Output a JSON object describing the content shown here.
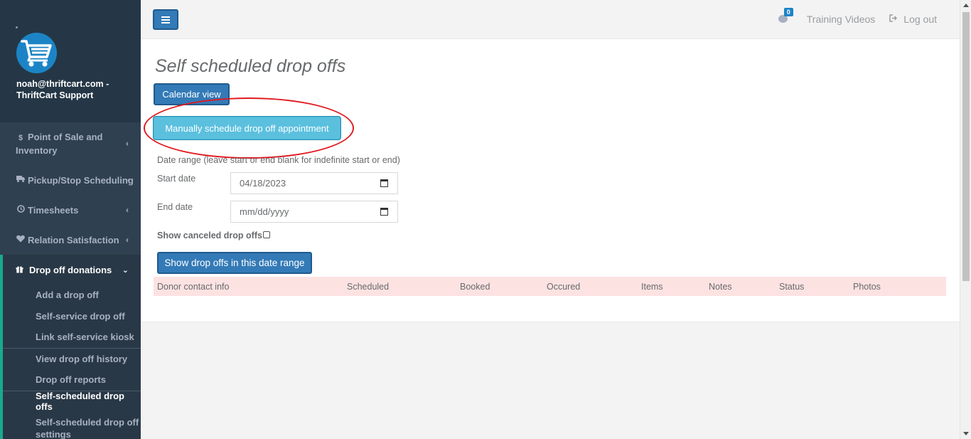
{
  "profile": {
    "name": "noah@thriftcart.com - ThriftCart Support"
  },
  "sidebar": {
    "items": [
      {
        "icon": "$",
        "label": "Point of Sale and Inventory"
      },
      {
        "icon": "truck-icon",
        "label": "Pickup/Stop Scheduling"
      },
      {
        "icon": "clock-icon",
        "label": "Timesheets"
      },
      {
        "icon": "heart-icon",
        "label": "Relation Satisfaction"
      }
    ],
    "active": {
      "label": "Drop off donations",
      "subitems": [
        "Add a drop off",
        "Self-service drop off",
        "Link self-service kiosk",
        "View drop off history",
        "Drop off reports",
        "Self-scheduled drop offs",
        "Self-scheduled drop off settings"
      ]
    }
  },
  "topbar": {
    "badge_count": "0",
    "training_videos": "Training Videos",
    "logout": "Log out"
  },
  "main": {
    "title": "Self scheduled drop offs",
    "calendar_button": "Calendar view",
    "manual_button": "Manually schedule drop off appointment",
    "date_range_label": "Date range (leave start or end blank for indefinite start or end)",
    "start_label": "Start date",
    "start_value": "04/18/2023",
    "end_label": "End date",
    "end_placeholder": "mm/dd/yyyy",
    "show_canceled_label": "Show canceled drop offs",
    "show_button": "Show drop offs in this date range",
    "table_headers": [
      "Donor contact info",
      "Scheduled",
      "Booked",
      "Occured",
      "Items",
      "Notes",
      "Status",
      "Photos"
    ]
  },
  "colors": {
    "sidebar": "#2f4050",
    "accent": "#19aa8d",
    "primary": "#337ab7",
    "info": "#5bc0de",
    "annotation": "#e0191f",
    "table_header": "#fde2e2"
  }
}
